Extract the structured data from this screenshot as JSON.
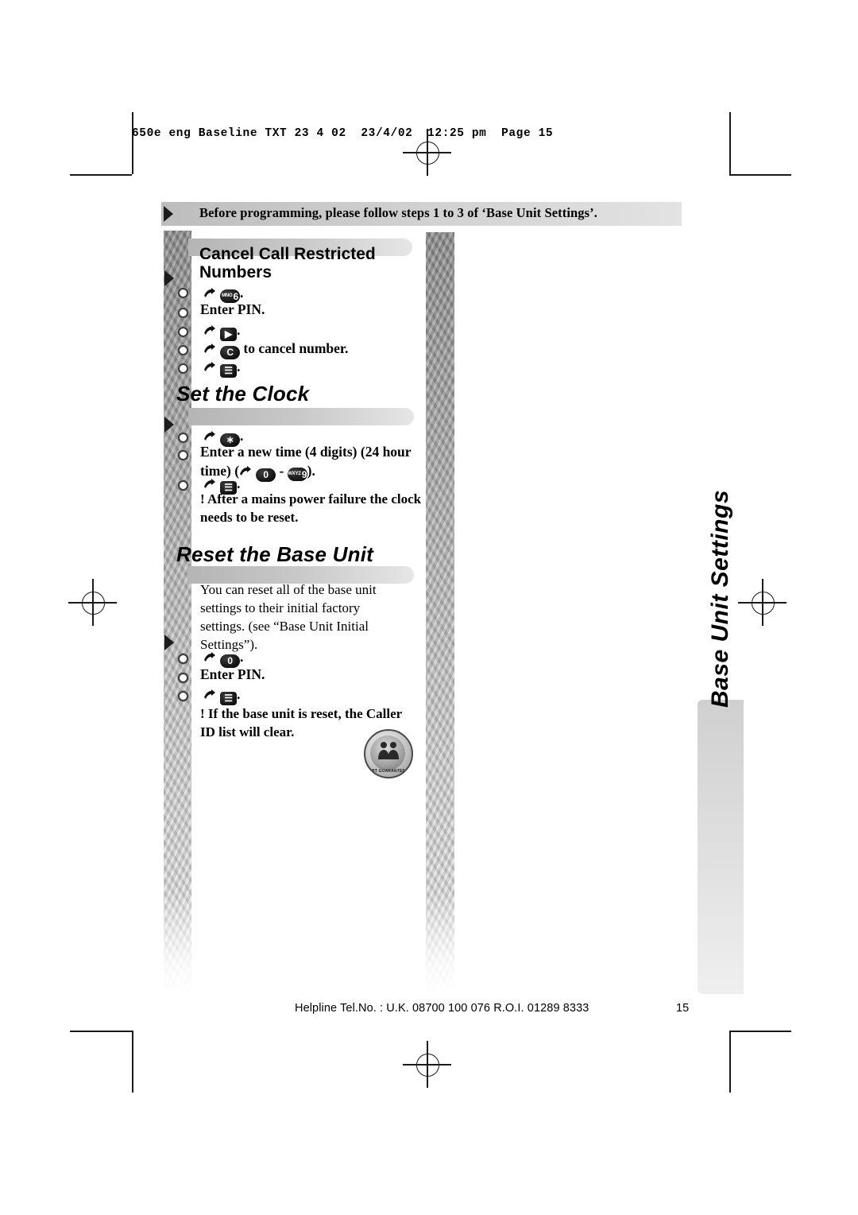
{
  "slug": "650e eng Baseline TXT 23 4 02  23/4/02  12:25 pm  Page 15",
  "banner": {
    "text": "Before programming, please follow steps 1 to 3 of ‘Base Unit Settings’."
  },
  "sections": [
    {
      "id": "cancel-call-restricted-numbers",
      "heading_line1": "Cancel Call Restricted",
      "heading_line2": "Numbers",
      "steps": [
        {
          "prefix": "",
          "key": "6",
          "key_sup": "MNO",
          "suffix": "."
        },
        {
          "text": "Enter PIN."
        },
        {
          "prefix": "",
          "key": "▶",
          "suffix": "."
        },
        {
          "prefix": "",
          "key": "C",
          "suffix": " to cancel number."
        },
        {
          "prefix": "",
          "key": "☰",
          "suffix": "."
        }
      ]
    },
    {
      "id": "set-the-clock",
      "heading": "Set the Clock",
      "steps": [
        {
          "key": "∗",
          "suffix": "."
        },
        {
          "text_a": "Enter a new time (4 digits) (24",
          "text_b": "hour time) (",
          "key1": "0",
          "dash": " - ",
          "key2": "9",
          "key2_sup": "WXYZ",
          "text_c": ")."
        },
        {
          "key": "☰",
          "suffix": "."
        }
      ],
      "note": "! After a mains power failure the clock needs to be reset."
    },
    {
      "id": "reset-the-base-unit",
      "heading": "Reset the Base Unit",
      "body": "You can reset all of the base unit settings to their initial factory settings. (see “Base Unit Initial Settings”).",
      "steps": [
        {
          "key": "0",
          "suffix": "."
        },
        {
          "text": "Enter PIN."
        },
        {
          "key": "☰",
          "suffix": "."
        }
      ],
      "note": "! If the base unit is reset, the Caller ID list will clear."
    }
  ],
  "badge": {
    "label": "BT GUARANTEE"
  },
  "side_tab": {
    "label": "Base Unit Settings"
  },
  "footer": {
    "helpline": "Helpline Tel.No. : U.K. 08700 100 076   R.O.I. 01289 8333",
    "page_number": "15"
  }
}
